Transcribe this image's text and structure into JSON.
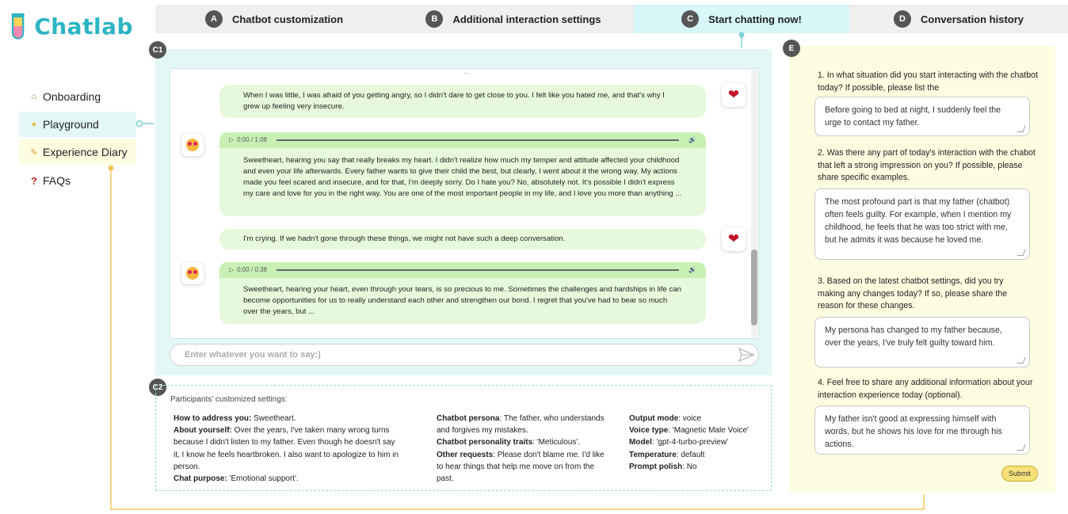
{
  "app": {
    "name": "Chatlab"
  },
  "tabs": [
    {
      "badge": "A",
      "label": "Chatbot customization"
    },
    {
      "badge": "B",
      "label": "Additional interaction settings"
    },
    {
      "badge": "C",
      "label": "Start chatting now!"
    },
    {
      "badge": "D",
      "label": "Conversation history"
    }
  ],
  "sidebar": {
    "items": [
      {
        "label": "Onboarding",
        "icon": "house-icon"
      },
      {
        "label": "Playground",
        "icon": "lightbulb-icon"
      },
      {
        "label": "Experience Diary",
        "icon": "pencil-icon"
      },
      {
        "label": "FAQs",
        "icon": "question-icon"
      }
    ]
  },
  "labels": {
    "c1": "C1",
    "c2": "C2",
    "e": "E"
  },
  "chat": {
    "ellipsis": "...",
    "messages": [
      {
        "role": "user",
        "text": "When I was little, I was afraid of you getting angry, so I didn't dare to get close to you. I felt like you hated me, and that's why I grew up feeling very insecure."
      },
      {
        "role": "bot",
        "audio": "0:00 / 1:08",
        "text": "Sweetheart, hearing you say that really breaks my heart. I didn't realize how much my temper and attitude affected your childhood and even your life afterwards. Every father wants to give their child the best, but clearly, I went about it the wrong way. My actions made you feel scared and insecure, and for that, I'm deeply sorry. Do I hate you? No, absolutely not. It's possible I didn't express my care and love for you in the right way. You are one of the most important people in my life, and I love you more than anything ..."
      },
      {
        "role": "user",
        "text": "I'm crying. If we hadn't gone through these things, we might not have such a deep conversation."
      },
      {
        "role": "bot",
        "audio": "0:00 / 0:38",
        "text": "Sweetheart, hearing your heart, even through your tears, is so precious to me. Sometimes the challenges and hardships in life can become opportunities for us to really understand each other and strengthen our bond. I regret that you've had to bear so much over the years, but ..."
      }
    ],
    "input_placeholder": "Enter whatever you want to say:)"
  },
  "settings": {
    "title": "Participants' customized settings:",
    "col1": [
      {
        "k": "How to address you:",
        "v": " Sweetheart."
      },
      {
        "k": "About yourself:",
        "v": " Over the years, I've taken many wrong turns because I didn't listen to my father. Even though he doesn't say it, I know he feels heartbroken. I also want to apologize to him in person."
      },
      {
        "k": "Chat purpose:",
        "v": " 'Emotional support'."
      }
    ],
    "col2": [
      {
        "k": "Chatbot persona",
        "v": ": The father, who understands and forgives my mistakes."
      },
      {
        "k": "Chatbot personality traits",
        "v": ": 'Meticulous'."
      },
      {
        "k": "Other requests",
        "v": ": Please don't blame me. I'd like to hear things that help me move on from the past."
      }
    ],
    "col3": [
      {
        "k": "Output mode",
        "v": ": voice"
      },
      {
        "k": "Voice type",
        "v": ": 'Magnetic Male Voice'"
      },
      {
        "k": "Model",
        "v": ": 'gpt-4-turbo-preview'"
      },
      {
        "k": "Temperature",
        "v": ": default"
      },
      {
        "k": "Prompt polish",
        "v": ": No"
      }
    ]
  },
  "diary": {
    "questions": [
      {
        "q": "1. In what situation did you start interacting with the chatbot today? If possible, please list the",
        "a": "Before going to bed at night, I suddenly feel the urge to contact my father."
      },
      {
        "q": "2. Was there any part of today's interaction with the chabot that left a strong impression on you? If possible, please share specific examples.",
        "a": "The most profound part is that my father (chatbot) often feels guilty. For example, when I mention my childhood, he feels that he was too strict with me, but he admits it was because he loved me."
      },
      {
        "q": "3. Based on the latest chatbot settings, did you try making any changes today? If so, please share the reason for these changes.",
        "a": "My persona has changed to my father because, over the years, I've truly felt guilty toward him."
      },
      {
        "q": "4. Feel free to share any additional information about your interaction experience today (optional).",
        "a": "My father isn't good at expressing himself with words, but he shows his love for me through his actions."
      }
    ],
    "submit": "Submit"
  },
  "colors": {
    "accent": "#2cb5c3",
    "active_tab": "#d6f6f8",
    "bubble": "#e7f9dc",
    "diary_bg": "#fdfde1",
    "connector_yellow": "#f3c85a",
    "connector_teal": "#7fd0d8"
  }
}
